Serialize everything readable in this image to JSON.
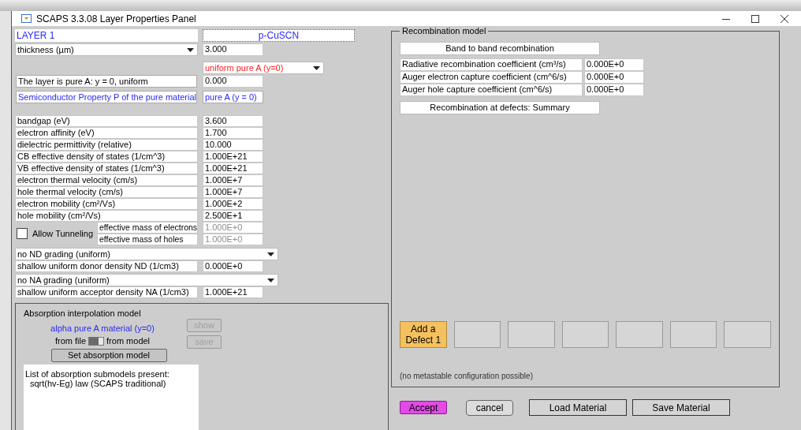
{
  "window": {
    "title": "SCAPS 3.3.08 Layer Properties Panel"
  },
  "layer": {
    "name": "LAYER 1",
    "material": "p-CuSCN"
  },
  "thickness": {
    "label": "thickness (µm)",
    "value": "3.000"
  },
  "composition": {
    "grading": "uniform pure A (y=0)",
    "description": "The layer is pure A: y = 0, uniform",
    "value": "0.000"
  },
  "property_header": {
    "label": "Semiconductor Property P of the pure material",
    "value": "pure A (y = 0)"
  },
  "properties": [
    {
      "label": "bandgap (eV)",
      "value": "3.600"
    },
    {
      "label": "electron affinity (eV)",
      "value": "1.700"
    },
    {
      "label": "dielectric permittivity (relative)",
      "value": "10.000"
    },
    {
      "label": "CB effective density of states (1/cm^3)",
      "value": "1.000E+21"
    },
    {
      "label": "VB effective density of states (1/cm^3)",
      "value": "1.000E+21"
    },
    {
      "label": "electron thermal velocity (cm/s)",
      "value": "1.000E+7"
    },
    {
      "label": "hole thermal velocity (cm/s)",
      "value": "1.000E+7"
    },
    {
      "label": "electron mobility (cm²/Vs)",
      "value": "1.000E+2"
    },
    {
      "label": "hole mobility (cm²/Vs)",
      "value": "2.500E+1"
    }
  ],
  "tunneling": {
    "label": "Allow Tunneling",
    "checked": false,
    "masses": [
      {
        "label": "effective mass of electrons",
        "value": "1.000E+0",
        "disabled": true
      },
      {
        "label": "effective mass of holes",
        "value": "1.000E+0",
        "disabled": true
      }
    ]
  },
  "doping": [
    {
      "grading": "no ND grading (uniform)",
      "label": "shallow uniform donor density ND (1/cm3)",
      "value": "0.000E+0"
    },
    {
      "grading": "no NA grading (uniform)",
      "label": "shallow uniform acceptor density NA (1/cm3)",
      "value": "1.000E+21"
    }
  ],
  "absorption": {
    "title": "Absorption interpolation model",
    "source": "alpha pure A material (y=0)",
    "switch_left": "from file",
    "switch_right": "from model",
    "switch_on": true,
    "set_button": "Set absorption model",
    "side_buttons": [
      {
        "label": "show",
        "disabled": true
      },
      {
        "label": "save",
        "disabled": true
      }
    ],
    "list_lines": [
      "List of absorption submodels present:",
      "sqrt(hv-Eg) law (SCAPS traditional)"
    ]
  },
  "recombination": {
    "title": "Recombination model",
    "band_button": "Band to band recombination",
    "rows": [
      {
        "label": "Radiative recombination coefficient (cm³/s)",
        "value": "0.000E+0"
      },
      {
        "label": "Auger electron capture coefficient (cm^6/s)",
        "value": "0.000E+0"
      },
      {
        "label": "Auger hole capture coefficient (cm^6/s)",
        "value": "0.000E+0"
      }
    ],
    "defects_button": "Recombination at defects: Summary",
    "defects": [
      {
        "kind": "add",
        "lines": [
          "Add a",
          "Defect 1"
        ]
      },
      {
        "kind": "empty"
      },
      {
        "kind": "empty"
      },
      {
        "kind": "empty"
      },
      {
        "kind": "empty"
      },
      {
        "kind": "empty"
      },
      {
        "kind": "empty"
      }
    ],
    "note": "(no metastable configuration possible)"
  },
  "buttons": [
    {
      "kind": "accept",
      "label": "Accept"
    },
    {
      "kind": "cancel",
      "label": "cancel"
    },
    {
      "kind": "load",
      "label": "Load Material"
    },
    {
      "kind": "save",
      "label": "Save Material"
    }
  ]
}
